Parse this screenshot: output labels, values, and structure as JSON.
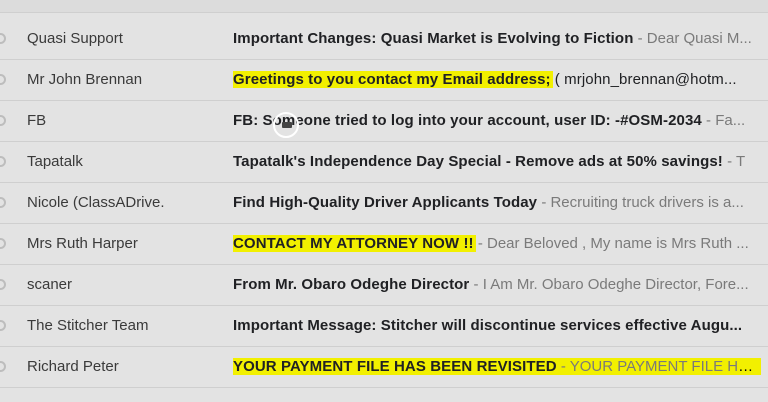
{
  "inbox": {
    "rows": [
      {
        "sender": "Quasi Support",
        "subject": "Important Changes: Quasi Market is Evolving to Fiction",
        "snippet": "- Dear Quasi M..."
      },
      {
        "sender": "Mr John Brennan",
        "subject": "Greetings to you contact my Email address;",
        "snippet": "( mrjohn_brennan@hotm..."
      },
      {
        "sender": "FB",
        "subject": "FB: Someone tried to log into your account, user ID: -#OSM-2034",
        "snippet": "- Fa..."
      },
      {
        "sender": "Tapatalk",
        "subject": "Tapatalk's Independence Day Special - Remove ads at 50% savings!",
        "snippet": "- T"
      },
      {
        "sender": "Nicole (ClassADrive.",
        "subject": "Find High-Quality Driver Applicants Today",
        "snippet": "- Recruiting truck drivers is a..."
      },
      {
        "sender": "Mrs Ruth Harper",
        "subject": "CONTACT MY ATTORNEY NOW !!",
        "snippet": "- Dear Beloved , My name is Mrs Ruth ..."
      },
      {
        "sender": "scaner",
        "subject": "From Mr. Obaro Odeghe Director",
        "snippet": "- I Am Mr. Obaro Odeghe Director, Fore..."
      },
      {
        "sender": "The Stitcher Team",
        "subject": "Important Message: Stitcher will discontinue services effective Augu...",
        "snippet": ""
      },
      {
        "sender": "Richard Peter",
        "subject": "YOUR PAYMENT FILE HAS BEEN REVISITED",
        "snippet": "- YOUR PAYMENT FILE HAS ..."
      }
    ]
  },
  "colors": {
    "highlight": "#f2f000",
    "background": "#e3e3e3"
  }
}
